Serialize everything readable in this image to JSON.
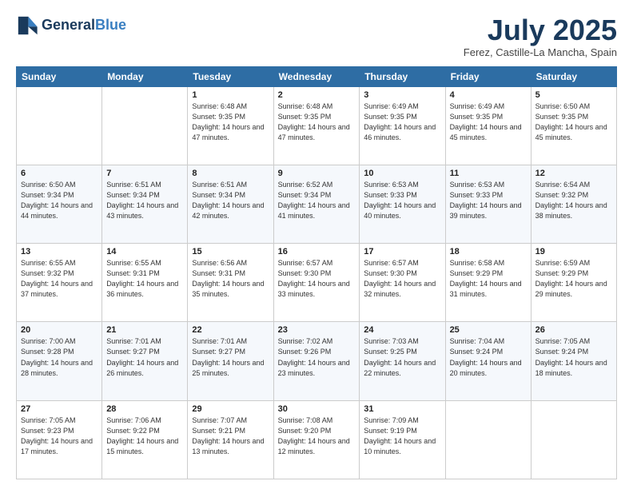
{
  "header": {
    "logo_line1": "General",
    "logo_line2": "Blue",
    "month": "July 2025",
    "location": "Ferez, Castille-La Mancha, Spain"
  },
  "days_of_week": [
    "Sunday",
    "Monday",
    "Tuesday",
    "Wednesday",
    "Thursday",
    "Friday",
    "Saturday"
  ],
  "weeks": [
    [
      null,
      null,
      {
        "day": 1,
        "sunrise": "6:48 AM",
        "sunset": "9:35 PM",
        "daylight": "14 hours and 47 minutes."
      },
      {
        "day": 2,
        "sunrise": "6:48 AM",
        "sunset": "9:35 PM",
        "daylight": "14 hours and 47 minutes."
      },
      {
        "day": 3,
        "sunrise": "6:49 AM",
        "sunset": "9:35 PM",
        "daylight": "14 hours and 46 minutes."
      },
      {
        "day": 4,
        "sunrise": "6:49 AM",
        "sunset": "9:35 PM",
        "daylight": "14 hours and 45 minutes."
      },
      {
        "day": 5,
        "sunrise": "6:50 AM",
        "sunset": "9:35 PM",
        "daylight": "14 hours and 45 minutes."
      }
    ],
    [
      {
        "day": 6,
        "sunrise": "6:50 AM",
        "sunset": "9:34 PM",
        "daylight": "14 hours and 44 minutes."
      },
      {
        "day": 7,
        "sunrise": "6:51 AM",
        "sunset": "9:34 PM",
        "daylight": "14 hours and 43 minutes."
      },
      {
        "day": 8,
        "sunrise": "6:51 AM",
        "sunset": "9:34 PM",
        "daylight": "14 hours and 42 minutes."
      },
      {
        "day": 9,
        "sunrise": "6:52 AM",
        "sunset": "9:34 PM",
        "daylight": "14 hours and 41 minutes."
      },
      {
        "day": 10,
        "sunrise": "6:53 AM",
        "sunset": "9:33 PM",
        "daylight": "14 hours and 40 minutes."
      },
      {
        "day": 11,
        "sunrise": "6:53 AM",
        "sunset": "9:33 PM",
        "daylight": "14 hours and 39 minutes."
      },
      {
        "day": 12,
        "sunrise": "6:54 AM",
        "sunset": "9:32 PM",
        "daylight": "14 hours and 38 minutes."
      }
    ],
    [
      {
        "day": 13,
        "sunrise": "6:55 AM",
        "sunset": "9:32 PM",
        "daylight": "14 hours and 37 minutes."
      },
      {
        "day": 14,
        "sunrise": "6:55 AM",
        "sunset": "9:31 PM",
        "daylight": "14 hours and 36 minutes."
      },
      {
        "day": 15,
        "sunrise": "6:56 AM",
        "sunset": "9:31 PM",
        "daylight": "14 hours and 35 minutes."
      },
      {
        "day": 16,
        "sunrise": "6:57 AM",
        "sunset": "9:30 PM",
        "daylight": "14 hours and 33 minutes."
      },
      {
        "day": 17,
        "sunrise": "6:57 AM",
        "sunset": "9:30 PM",
        "daylight": "14 hours and 32 minutes."
      },
      {
        "day": 18,
        "sunrise": "6:58 AM",
        "sunset": "9:29 PM",
        "daylight": "14 hours and 31 minutes."
      },
      {
        "day": 19,
        "sunrise": "6:59 AM",
        "sunset": "9:29 PM",
        "daylight": "14 hours and 29 minutes."
      }
    ],
    [
      {
        "day": 20,
        "sunrise": "7:00 AM",
        "sunset": "9:28 PM",
        "daylight": "14 hours and 28 minutes."
      },
      {
        "day": 21,
        "sunrise": "7:01 AM",
        "sunset": "9:27 PM",
        "daylight": "14 hours and 26 minutes."
      },
      {
        "day": 22,
        "sunrise": "7:01 AM",
        "sunset": "9:27 PM",
        "daylight": "14 hours and 25 minutes."
      },
      {
        "day": 23,
        "sunrise": "7:02 AM",
        "sunset": "9:26 PM",
        "daylight": "14 hours and 23 minutes."
      },
      {
        "day": 24,
        "sunrise": "7:03 AM",
        "sunset": "9:25 PM",
        "daylight": "14 hours and 22 minutes."
      },
      {
        "day": 25,
        "sunrise": "7:04 AM",
        "sunset": "9:24 PM",
        "daylight": "14 hours and 20 minutes."
      },
      {
        "day": 26,
        "sunrise": "7:05 AM",
        "sunset": "9:24 PM",
        "daylight": "14 hours and 18 minutes."
      }
    ],
    [
      {
        "day": 27,
        "sunrise": "7:05 AM",
        "sunset": "9:23 PM",
        "daylight": "14 hours and 17 minutes."
      },
      {
        "day": 28,
        "sunrise": "7:06 AM",
        "sunset": "9:22 PM",
        "daylight": "14 hours and 15 minutes."
      },
      {
        "day": 29,
        "sunrise": "7:07 AM",
        "sunset": "9:21 PM",
        "daylight": "14 hours and 13 minutes."
      },
      {
        "day": 30,
        "sunrise": "7:08 AM",
        "sunset": "9:20 PM",
        "daylight": "14 hours and 12 minutes."
      },
      {
        "day": 31,
        "sunrise": "7:09 AM",
        "sunset": "9:19 PM",
        "daylight": "14 hours and 10 minutes."
      },
      null,
      null
    ]
  ]
}
